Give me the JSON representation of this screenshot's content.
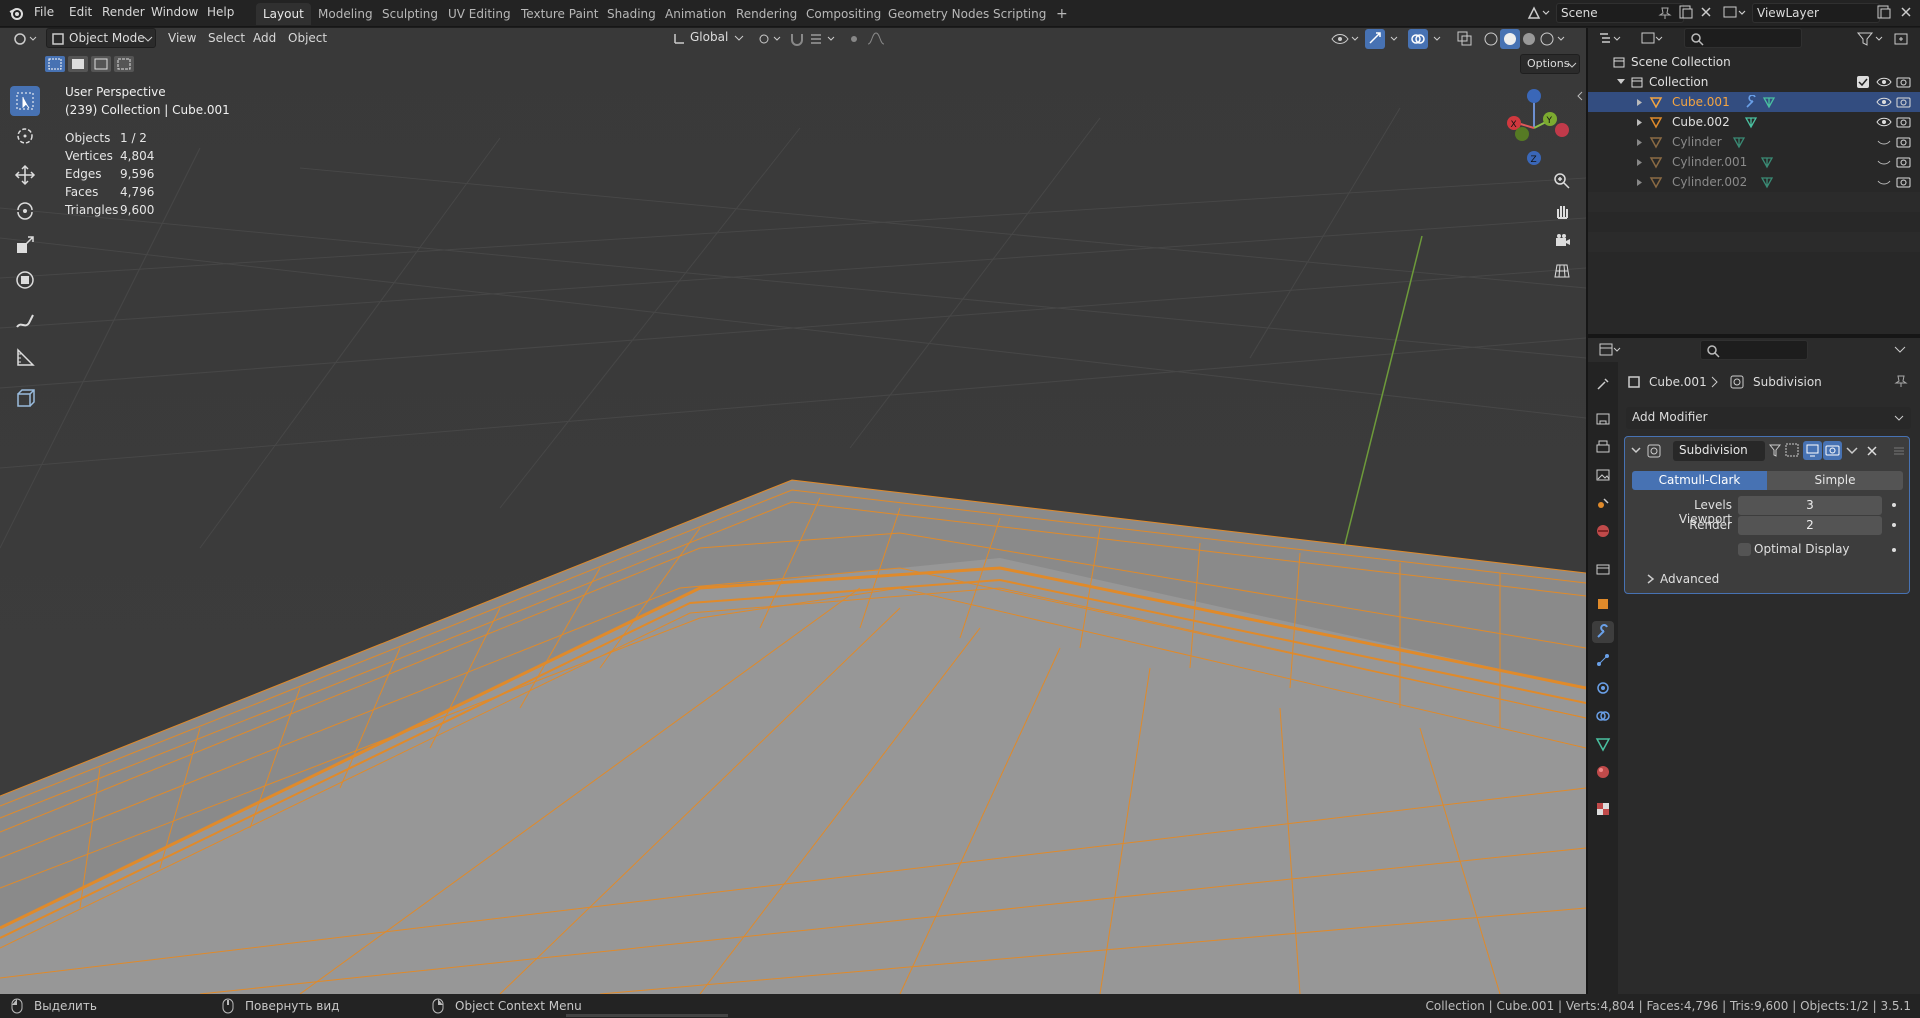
{
  "menus": [
    "File",
    "Edit",
    "Render",
    "Window",
    "Help"
  ],
  "workspaces": [
    "Layout",
    "Modeling",
    "Sculpting",
    "UV Editing",
    "Texture Paint",
    "Shading",
    "Animation",
    "Rendering",
    "Compositing",
    "Geometry Nodes",
    "Scripting"
  ],
  "add_workspace": "+",
  "scene": "Scene",
  "view_layer": "ViewLayer",
  "viewport": {
    "mode": "Object Mode",
    "menus": [
      "View",
      "Select",
      "Add",
      "Object"
    ],
    "orientation": "Global",
    "options": "Options",
    "perspective": "User Perspective",
    "collection_info": "(239) Collection | Cube.001",
    "stats": [
      {
        "label": "Objects",
        "value": "1 / 2"
      },
      {
        "label": "Vertices",
        "value": "4,804"
      },
      {
        "label": "Edges",
        "value": "9,596"
      },
      {
        "label": "Faces",
        "value": "4,796"
      },
      {
        "label": "Triangles",
        "value": "9,600"
      }
    ],
    "gizmo": {
      "x": "X",
      "y": "Y",
      "z": "Z"
    }
  },
  "outliner": {
    "scene_collection": "Scene Collection",
    "collection": "Collection",
    "items": [
      "Cube.001",
      "Cube.002",
      "Cylinder",
      "Cylinder.001",
      "Cylinder.002"
    ]
  },
  "properties": {
    "object": "Cube.001",
    "modifier_crumb": "Subdivision",
    "add_modifier": "Add Modifier",
    "modifier_name": "Subdivision",
    "catmull": "Catmull-Clark",
    "simple": "Simple",
    "levels_label": "Levels Viewport",
    "levels_value": "3",
    "render_label": "Render",
    "render_value": "2",
    "optimal": "Optimal Display",
    "advanced": "Advanced"
  },
  "status": {
    "left": "Выделить",
    "middle": "Повернуть вид",
    "right": "Object Context Menu",
    "info": "Collection | Cube.001 | Verts:4,804 | Faces:4,796 | Tris:9,600 | Objects:1/2 | 3.5.1"
  },
  "colors": {
    "accent": "#4772b3",
    "selection": "#f0922b",
    "active_text": "#f5a541"
  }
}
